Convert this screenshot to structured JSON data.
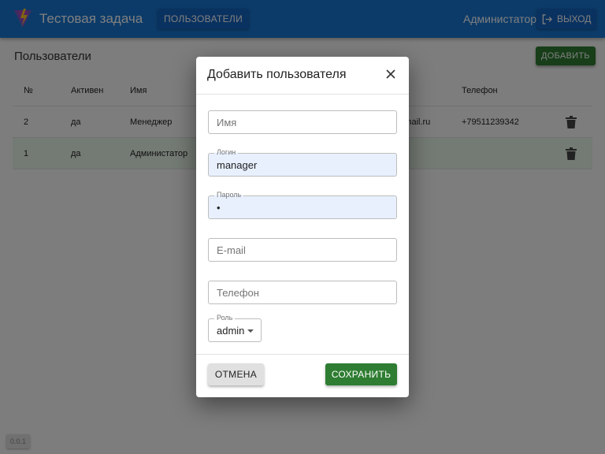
{
  "app": {
    "title": "Тестовая задача",
    "version": "0.0.1"
  },
  "header": {
    "nav_users": "ПОЛЬЗОВАТЕЛИ",
    "user_name": "Администатор",
    "logout": "ВЫХОД"
  },
  "page": {
    "title": "Пользователи",
    "add_button": "ДОБАВИТЬ",
    "columns": [
      "№",
      "Активен",
      "Имя",
      "Телефон"
    ],
    "rows": [
      {
        "num": "2",
        "active": "да",
        "name": "Менеджер",
        "email": "@email.ru",
        "phone": "+79511239342"
      },
      {
        "num": "1",
        "active": "да",
        "name": "Администатор",
        "email": "",
        "phone": ""
      }
    ]
  },
  "dialog": {
    "title": "Добавить пользователя",
    "name_placeholder": "Имя",
    "login_label": "Логин",
    "login_value": "manager",
    "password_label": "Пароль",
    "password_value": "•",
    "email_placeholder": "E-mail",
    "phone_placeholder": "Телефон",
    "role_label": "Роль",
    "role_value": "admin",
    "cancel": "ОТМЕНА",
    "save": "СОХРАНИТЬ"
  },
  "colors": {
    "appbar": "#1976d2",
    "success": "#2e7d32",
    "highlight_row": "#e8f5e9",
    "autofill": "#e8f0fe"
  }
}
